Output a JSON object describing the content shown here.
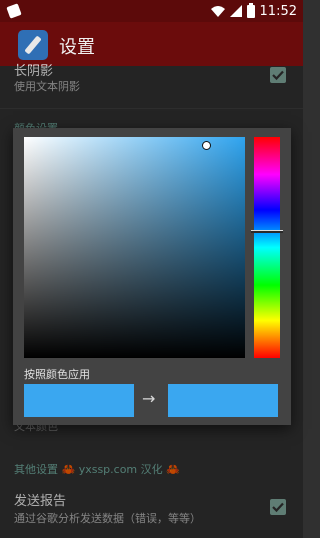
{
  "status_bar": {
    "time": "11:52"
  },
  "toolbar": {
    "title": "设置"
  },
  "prefs": {
    "shadow": {
      "title": "长阴影",
      "summary": "使用文本阴影",
      "checked": true
    },
    "color_section": "颜色设置",
    "text_color_partial": "文本颜色",
    "other_section": "其他设置 🦀 yxssp.com 汉化 🦀",
    "report": {
      "title": "发送报告",
      "summary": "通过谷歌分析发送数据（错误，等等）",
      "checked": true
    }
  },
  "color_dialog": {
    "apply_label": "按照颜色应用",
    "arrow": "→",
    "old_color": "#3aa7f0",
    "new_color": "#3aa7f0",
    "hue_color": "#2fa4ef"
  },
  "colors": {
    "primary": "#6b0c0c",
    "status_bar": "#5c0a0a",
    "accent": "#6fa89c",
    "background": "#303030"
  }
}
